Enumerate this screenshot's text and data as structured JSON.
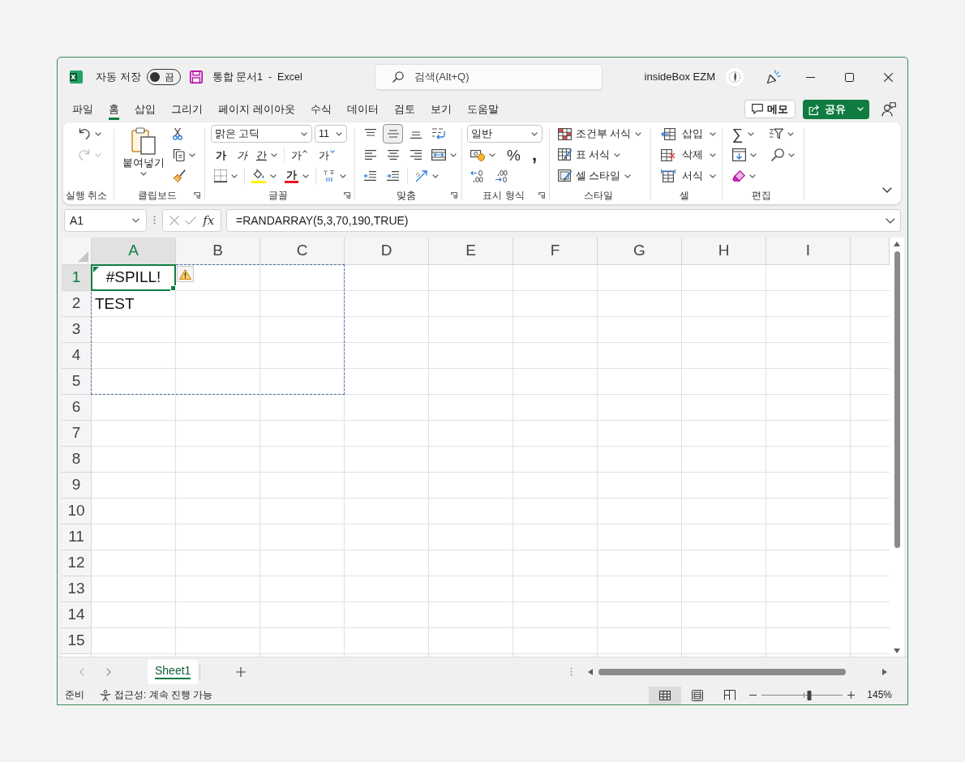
{
  "title_bar": {
    "autosave_label": "자동 저장",
    "autosave_on": false,
    "autosave_state": "끔",
    "title": "통합 문서1  -  Excel",
    "search_placeholder": "검색(Alt+Q)",
    "user_name": "insideBox EZM"
  },
  "menu_tabs": [
    {
      "label": "파일",
      "selected": false
    },
    {
      "label": "홈",
      "selected": true
    },
    {
      "label": "삽입",
      "selected": false
    },
    {
      "label": "그리기",
      "selected": false
    },
    {
      "label": "페이지 레이아웃",
      "selected": false
    },
    {
      "label": "수식",
      "selected": false
    },
    {
      "label": "데이터",
      "selected": false
    },
    {
      "label": "검토",
      "selected": false
    },
    {
      "label": "보기",
      "selected": false
    },
    {
      "label": "도움말",
      "selected": false
    }
  ],
  "menu_buttons": {
    "comments": "메모",
    "share": "공유"
  },
  "ribbon": {
    "undo": {
      "label": "실행 취소",
      "redo_disabled": true
    },
    "clipboard": {
      "label": "클립보드",
      "paste": "붙여넣기"
    },
    "font": {
      "label": "글꼴",
      "font_name": "맑은 고딕",
      "font_size": "11",
      "bold": "가",
      "italic": "가",
      "underline": "간",
      "grow": "가",
      "shrink": "가",
      "font_color": "가"
    },
    "alignment": {
      "label": "맞춤",
      "vertical_align": [
        {
          "selected": false
        },
        {
          "selected": true
        },
        {
          "selected": false
        }
      ]
    },
    "number": {
      "label": "표시 형식",
      "format": "일반",
      "percent": "%",
      "comma": ","
    },
    "styles": {
      "label": "스타일",
      "buttons": [
        "조건부 서식",
        "표 서식",
        "셀 스타일"
      ]
    },
    "cells": {
      "label": "셀",
      "buttons": [
        "삽입",
        "삭제",
        "서식"
      ]
    },
    "editing": {
      "label": "편집",
      "autosum": "∑"
    }
  },
  "formula_bar": {
    "name_box": "A1",
    "function_label": "fx",
    "formula": "=RANDARRAY(5,3,70,190,TRUE)"
  },
  "sheet": {
    "columns": [
      {
        "label": "A",
        "selected": true
      },
      {
        "label": "B",
        "selected": false
      },
      {
        "label": "C",
        "selected": false
      },
      {
        "label": "D",
        "selected": false
      },
      {
        "label": "E",
        "selected": false
      },
      {
        "label": "F",
        "selected": false
      },
      {
        "label": "G",
        "selected": false
      },
      {
        "label": "H",
        "selected": false
      },
      {
        "label": "I",
        "selected": false
      }
    ],
    "rows": [
      {
        "label": "1",
        "selected": true,
        "cells": [
          {
            "text": "#SPILL!",
            "kind": "error",
            "selected": true,
            "spill_outline": true
          }
        ]
      },
      {
        "label": "2",
        "selected": false,
        "cells": [
          {
            "text": "TEST",
            "kind": "text",
            "selected": false
          }
        ]
      },
      {
        "label": "3",
        "selected": false
      },
      {
        "label": "4",
        "selected": false
      },
      {
        "label": "5",
        "selected": false
      },
      {
        "label": "6",
        "selected": false
      },
      {
        "label": "7",
        "selected": false
      },
      {
        "label": "8",
        "selected": false
      },
      {
        "label": "9",
        "selected": false
      },
      {
        "label": "10",
        "selected": false
      },
      {
        "label": "11",
        "selected": false
      },
      {
        "label": "12",
        "selected": false
      },
      {
        "label": "13",
        "selected": false
      },
      {
        "label": "14",
        "selected": false
      },
      {
        "label": "15",
        "selected": false
      }
    ]
  },
  "sheet_tabs": [
    {
      "label": "Sheet1",
      "selected": true
    }
  ],
  "status_bar": {
    "mode": "준비",
    "accessibility": "접근성: 계속 진행 가능",
    "views": [
      {
        "selected": true
      },
      {
        "selected": false
      },
      {
        "selected": false
      }
    ],
    "zoom": {
      "level": 0.59,
      "reading": "145%"
    }
  }
}
